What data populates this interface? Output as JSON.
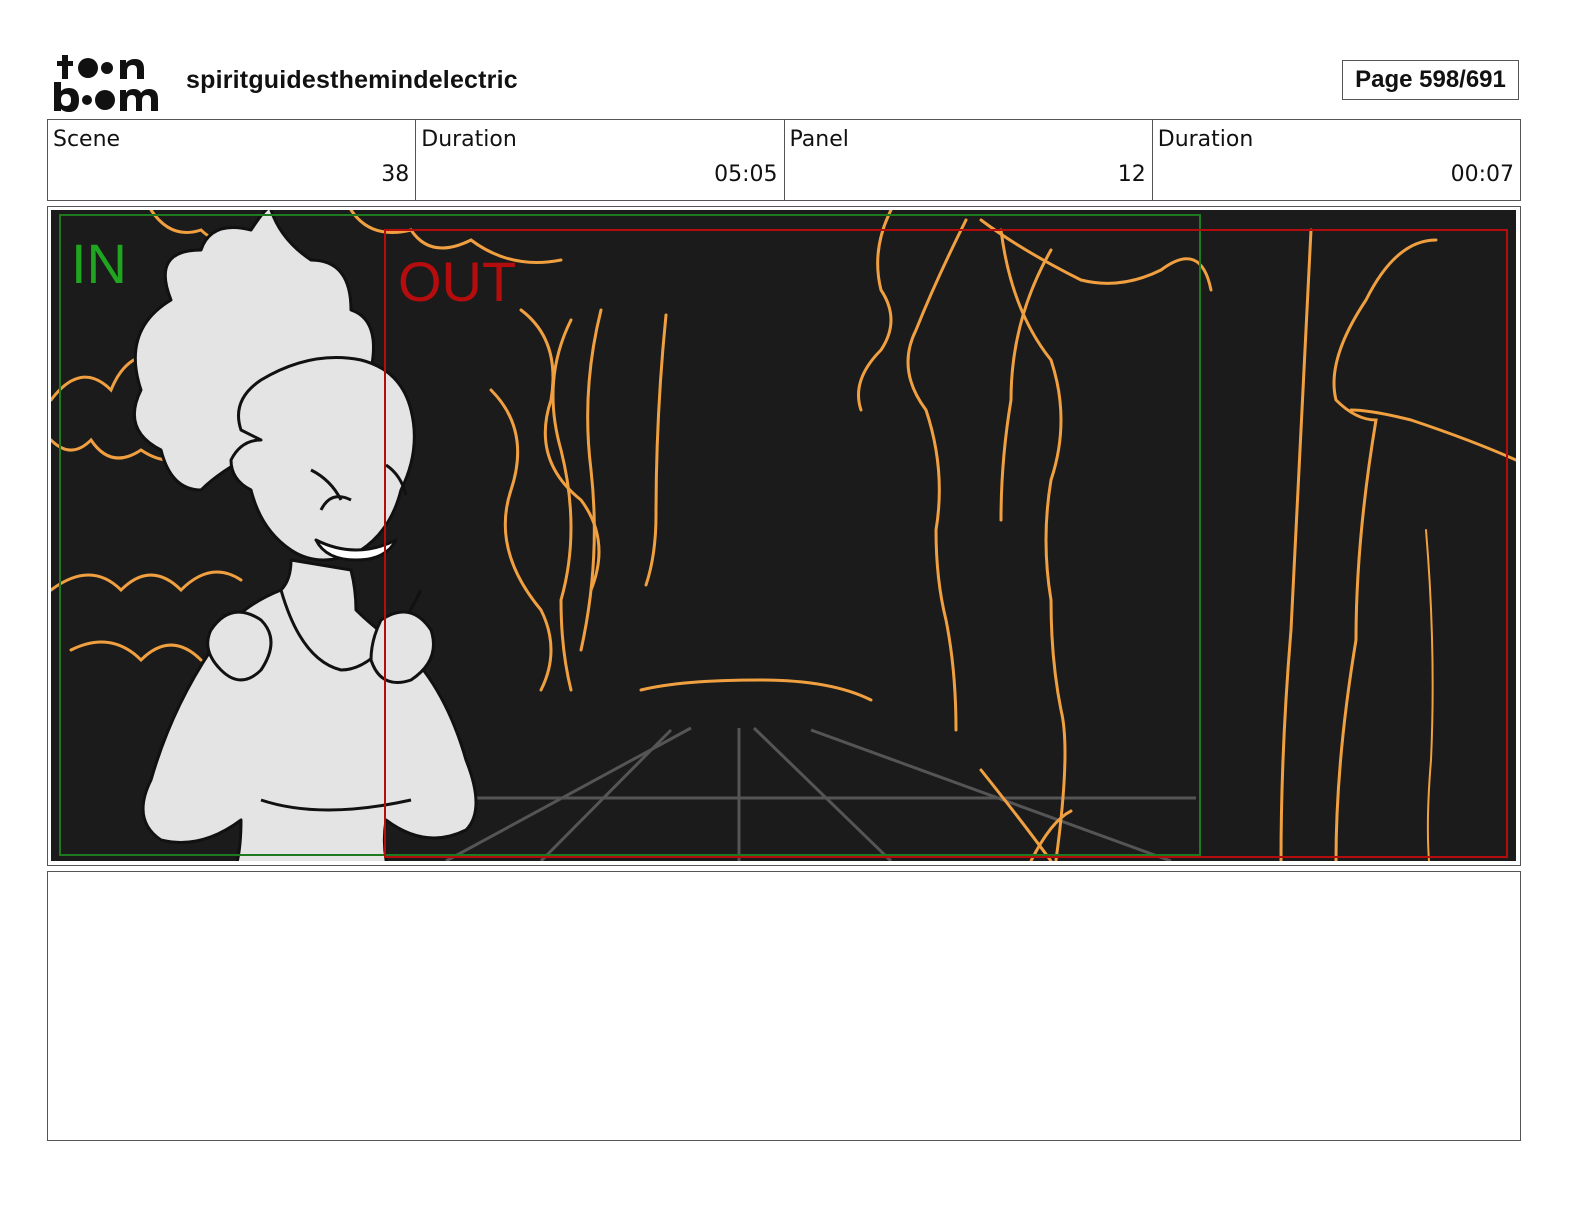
{
  "header": {
    "logo_text": "toon boom",
    "project_name": "spiritguidesthemindelectric",
    "page_label": "Page 598/691"
  },
  "info": {
    "scene_label": "Scene",
    "scene_value": "38",
    "scene_duration_label": "Duration",
    "scene_duration_value": "05:05",
    "panel_label": "Panel",
    "panel_value": "12",
    "panel_duration_label": "Duration",
    "panel_duration_value": "00:07"
  },
  "panel": {
    "in_label": "IN",
    "out_label": "OUT",
    "colors": {
      "background": "#1b1b1b",
      "sketch_orange": "#f0a040",
      "in_field": "#1fa51f",
      "out_field": "#b50d0d",
      "character_fill": "#e4e4e4"
    }
  },
  "notes": {
    "text": ""
  }
}
